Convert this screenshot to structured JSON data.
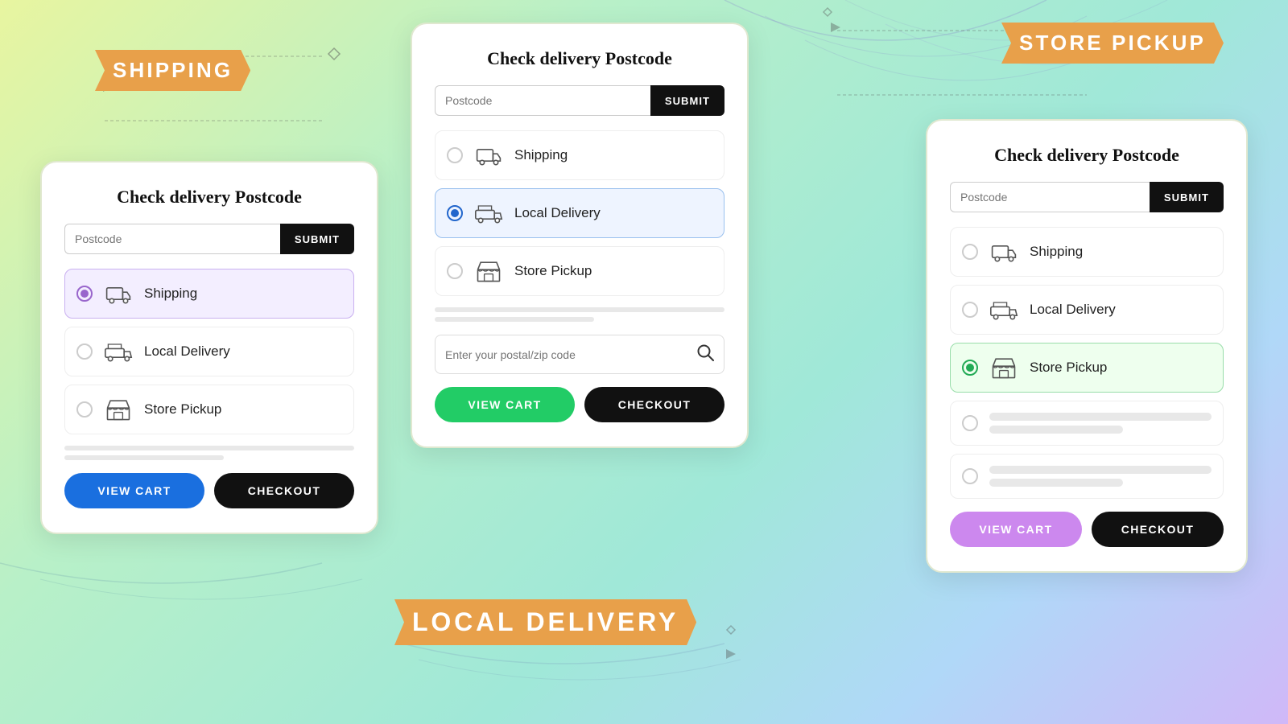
{
  "background": {
    "gradient": "linear-gradient(135deg, #e8f5a0, #b8f0c8, #a0e8d8, #b0d8f8, #d0b8f8)"
  },
  "banners": {
    "shipping": "SHIPPING",
    "store_pickup": "STORE PICKUP",
    "local_delivery": "LOCAL DELIVERY"
  },
  "card_left": {
    "title": "Check delivery Postcode",
    "postcode_placeholder": "Postcode",
    "submit_label": "SUBMIT",
    "options": [
      {
        "label": "Shipping",
        "selected": true,
        "selection_style": "purple"
      },
      {
        "label": "Local Delivery",
        "selected": false
      },
      {
        "label": "Store Pickup",
        "selected": false
      }
    ],
    "view_cart_label": "VIEW CART",
    "checkout_label": "CHECKOUT"
  },
  "card_center": {
    "title": "Check delivery Postcode",
    "postcode_placeholder": "Postcode",
    "submit_label": "SUBMIT",
    "options": [
      {
        "label": "Shipping",
        "selected": false
      },
      {
        "label": "Local Delivery",
        "selected": true,
        "selection_style": "blue"
      },
      {
        "label": "Store Pickup",
        "selected": false
      }
    ],
    "search_placeholder": "Enter your postal/zip code",
    "view_cart_label": "VIEW CART",
    "checkout_label": "CHECKOUT"
  },
  "card_right": {
    "title": "Check delivery Postcode",
    "postcode_placeholder": "Postcode",
    "submit_label": "SUBMIT",
    "options": [
      {
        "label": "Shipping",
        "selected": false
      },
      {
        "label": "Local Delivery",
        "selected": false
      },
      {
        "label": "Store Pickup",
        "selected": true,
        "selection_style": "green"
      }
    ],
    "view_cart_label": "VIEW CART",
    "checkout_label": "CHECKOUT"
  }
}
